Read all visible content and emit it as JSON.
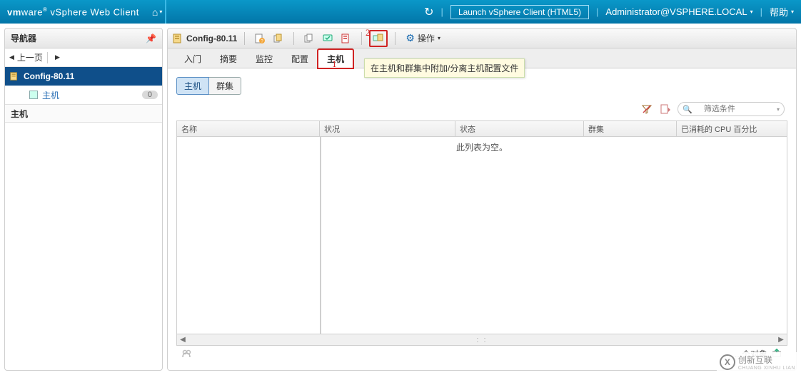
{
  "topbar": {
    "brand_prefix": "vm",
    "brand_suffix": "ware",
    "product": "vSphere Web Client",
    "launch_label": "Launch vSphere Client (HTML5)",
    "user": "Administrator@VSPHERE.LOCAL",
    "help": "帮助"
  },
  "nav": {
    "title": "导航器",
    "prev": "上一页",
    "root": "Config-80.11",
    "child": "主机",
    "child_count": "0",
    "hosts_header": "主机"
  },
  "main": {
    "title": "Config-80.11",
    "actions": "操作",
    "tabs": [
      "入门",
      "摘要",
      "监控",
      "配置",
      "主机"
    ],
    "active_tab": "主机",
    "subtabs": [
      "主机",
      "群集"
    ],
    "active_subtab": "主机",
    "search_placeholder": "筛选条件",
    "columns": [
      "名称",
      "状况",
      "状态",
      "群集",
      "已消耗的 CPU 百分比"
    ],
    "empty": "此列表为空。",
    "objects": "... 个对象"
  },
  "tooltip": "在主机和群集中附加/分离主机配置文件",
  "annotations": {
    "a1": "1",
    "a2": "2"
  },
  "watermark": {
    "cn": "创新互联",
    "en": "CHUANG XINHU LIAN"
  }
}
